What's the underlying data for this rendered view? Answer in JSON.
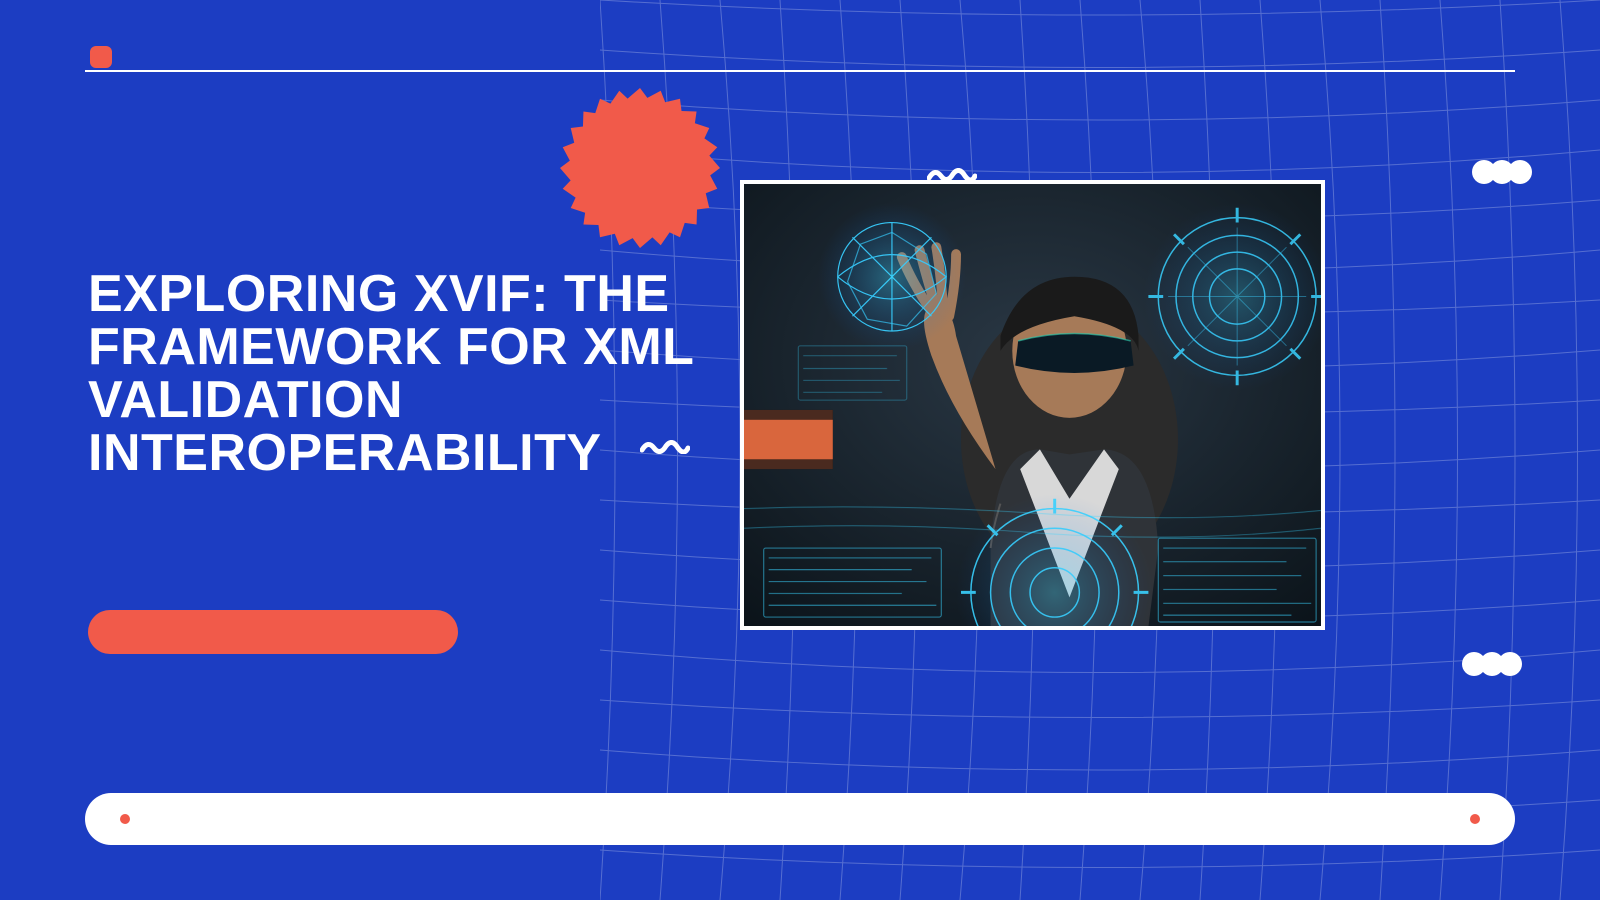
{
  "headline": "EXPLORING XVIF: THE FRAMEWORK FOR XML VALIDATION INTEROPERABILITY",
  "colors": {
    "bg": "#1c3dc2",
    "accent": "#f15a4a",
    "fg": "#ffffff"
  }
}
